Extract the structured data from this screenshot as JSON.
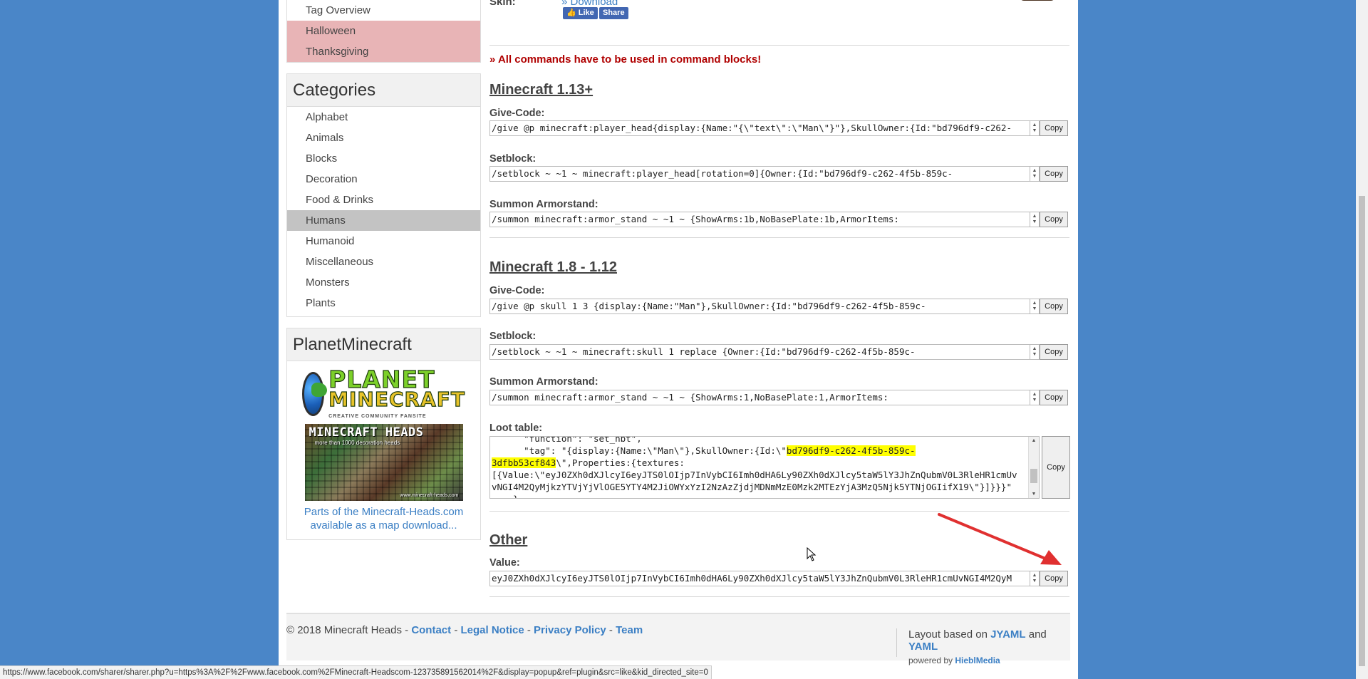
{
  "sidebar": {
    "tag_items": [
      {
        "label": "Tag Overview",
        "style": "normal"
      },
      {
        "label": "Halloween",
        "style": "pink"
      },
      {
        "label": "Thanksgiving",
        "style": "pink"
      }
    ],
    "categories_title": "Categories",
    "categories": [
      {
        "label": "Alphabet"
      },
      {
        "label": "Animals"
      },
      {
        "label": "Blocks"
      },
      {
        "label": "Decoration"
      },
      {
        "label": "Food & Drinks"
      },
      {
        "label": "Humans",
        "active": true
      },
      {
        "label": "Humanoid"
      },
      {
        "label": "Miscellaneous"
      },
      {
        "label": "Monsters"
      },
      {
        "label": "Plants"
      }
    ],
    "planet_title": "PlanetMinecraft",
    "planet_logo_line1": "PLANET",
    "planet_logo_line2": "MINECRAFT",
    "planet_logo_sub": "CREATIVE COMMUNITY FANSITE",
    "heads_banner_title": "MINECRAFT HEADS",
    "heads_banner_sub": "more than 1000 decoration heads",
    "heads_banner_url": "www.minecraft-heads.com",
    "planet_caption_1": "Parts of the Minecraft-Heads.com",
    "planet_caption_2": "available as a map download..."
  },
  "skin": {
    "label": "Skin:",
    "download": "» Download",
    "like": "Like",
    "share": "Share"
  },
  "notice": "» All commands have to be used in command blocks!",
  "section_113": {
    "title": "Minecraft 1.13+",
    "give_label": "Give-Code:",
    "give_value": "/give @p minecraft:player_head{display:{Name:\"{\\\"text\\\":\\\"Man\\\"}\"},SkullOwner:{Id:\"bd796df9-c262-",
    "setblock_label": "Setblock:",
    "setblock_value": "/setblock ~ ~1 ~ minecraft:player_head[rotation=0]{Owner:{Id:\"bd796df9-c262-4f5b-859c-",
    "summon_label": "Summon Armorstand:",
    "summon_value": "/summon minecraft:armor_stand ~ ~1 ~ {ShowArms:1b,NoBasePlate:1b,ArmorItems:"
  },
  "section_18": {
    "title": "Minecraft 1.8 - 1.12",
    "give_label": "Give-Code:",
    "give_value": "/give @p skull 1 3 {display:{Name:\"Man\"},SkullOwner:{Id:\"bd796df9-c262-4f5b-859c-",
    "setblock_label": "Setblock:",
    "setblock_value": "/setblock ~ ~1 ~ minecraft:skull 1 replace {Owner:{Id:\"bd796df9-c262-4f5b-859c-",
    "summon_label": "Summon Armorstand:",
    "summon_value": "/summon minecraft:armor_stand ~ ~1 ~ {ShowArms:1,NoBasePlate:1,ArmorItems:",
    "loot_label": "Loot table:",
    "loot_line0": "      \"function\": \"set_nbt\",",
    "loot_line1_a": "      \"tag\": \"{display:{Name:\\\"Man\\\"},SkullOwner:{Id:\\\"",
    "loot_line1_hl": "bd796df9-c262-4f5b-859c-",
    "loot_line2_hl": "3dfbb53cf843",
    "loot_line2_b": "\\\",Properties:{textures:",
    "loot_line3": "[{Value:\\\"eyJ0ZXh0dXJlcyI6eyJTS0lOIjp7InVybCI6Imh0dHA6Ly90ZXh0dXJlcy5taW5lY3JhZnQubmV0L3RleHR1cmUv",
    "loot_line4": "vNGI4M2QyMjkzYTVjYjVlOGE5YTY4M2JiOWYxYzI2NzAzZjdjMDNmMzE0Mzk2MTEzYjA3MzQ5Njk5YTNjOGIifX19\\\"}]}}}\"",
    "loot_line5": "    }"
  },
  "section_other": {
    "title": "Other",
    "value_label": "Value:",
    "value": "eyJ0ZXh0dXJlcyI6eyJTS0lOIjp7InVybCI6Imh0dHA6Ly90ZXh0dXJlcy5taW5lY3JhZnQubmV0L3RleHR1cmUvNGI4M2QyM"
  },
  "copy_label": "Copy",
  "footer": {
    "copyright": "© 2018 Minecraft Heads - ",
    "contact": "Contact",
    "legal": "Legal Notice",
    "privacy": "Privacy Policy",
    "team": "Team",
    "sep": " - ",
    "layout_prefix": "Layout based on ",
    "jyaml": "JYAML",
    "and": " and ",
    "yaml": "YAML",
    "powered": "powered by ",
    "hiebl": "HieblMedia"
  },
  "status_url": "https://www.facebook.com/sharer/sharer.php?u=https%3A%2F%2Fwww.facebook.com%2FMinecraft-Headscom-123735891562014%2F&display=popup&ref=plugin&src=like&kid_directed_site=0",
  "colors": {
    "background": "#4a86c8",
    "link": "#3b7fc4",
    "notice": "#b00000",
    "pink_item": "#e8b4b6",
    "active_item": "#c3c3c3",
    "highlight": "#ffff00",
    "arrow": "#e03030"
  }
}
